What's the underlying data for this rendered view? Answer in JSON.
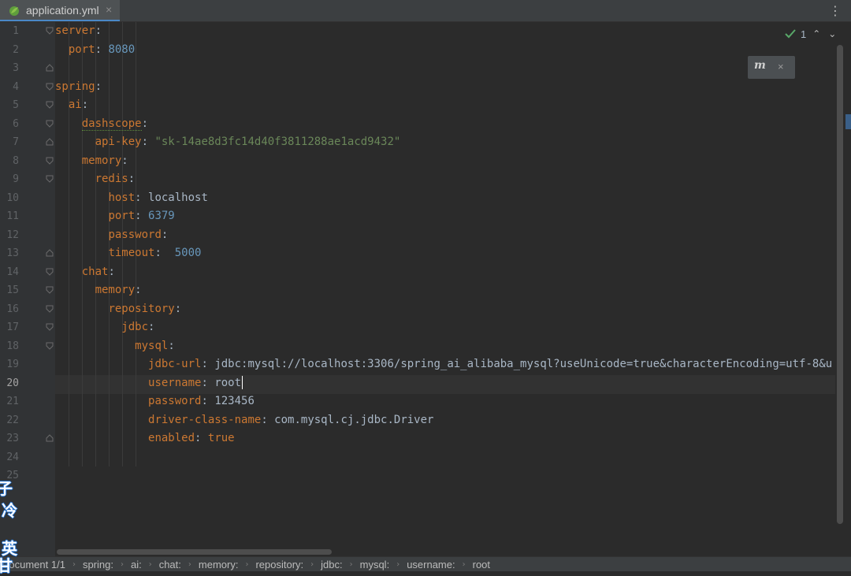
{
  "tab": {
    "filename": "application.yml",
    "close_glyph": "×"
  },
  "menu_glyph": "⋮",
  "inspection": {
    "count": "1",
    "up_glyph": "⌃",
    "down_glyph": "⌄"
  },
  "popup": {
    "logo_glyph": "m",
    "close_glyph": "×"
  },
  "gutter": {
    "line_numbers": [
      "1",
      "2",
      "3",
      "4",
      "5",
      "6",
      "7",
      "8",
      "9",
      "10",
      "11",
      "12",
      "13",
      "14",
      "15",
      "16",
      "17",
      "18",
      "19",
      "20",
      "21",
      "22",
      "23",
      "24",
      "25"
    ],
    "current_line": "20"
  },
  "code": {
    "l1_key": "server",
    "l2_key": "port",
    "l2_val": "8080",
    "l4_key": "spring",
    "l5_key": "ai",
    "l6_key": "dashscope",
    "l7_key": "api-key",
    "l7_val": "\"sk-14ae8d3fc14d40f3811288ae1acd9432\"",
    "l8_key": "memory",
    "l9_key": "redis",
    "l10_key": "host",
    "l10_val": "localhost",
    "l11_key": "port",
    "l11_val": "6379",
    "l12_key": "password",
    "l13_key": "timeout",
    "l13_val": "5000",
    "l14_key": "chat",
    "l15_key": "memory",
    "l16_key": "repository",
    "l17_key": "jdbc",
    "l18_key": "mysql",
    "l19_key": "jdbc-url",
    "l19_val": "jdbc:mysql://localhost:3306/spring_ai_alibaba_mysql?useUnicode=true&characterEncoding=utf-8&u",
    "l20_key": "username",
    "l20_val": "root",
    "l21_key": "password",
    "l21_val": "123456",
    "l22_key": "driver-class-name",
    "l22_val": "com.mysql.cj.jdbc.Driver",
    "l23_key": "enabled",
    "l23_val": "true"
  },
  "breadcrumbs": [
    "Document 1/1",
    "spring:",
    "ai:",
    "chat:",
    "memory:",
    "repository:",
    "jdbc:",
    "mysql:",
    "username:",
    "root"
  ],
  "overlay_chars": [
    "子",
    "冷",
    "英",
    "甘"
  ],
  "colors": {
    "key": "#cc7832",
    "number": "#6897bb",
    "string": "#6a8759",
    "text": "#a9b7c6",
    "background": "#2b2b2b",
    "gutter": "#313335"
  }
}
